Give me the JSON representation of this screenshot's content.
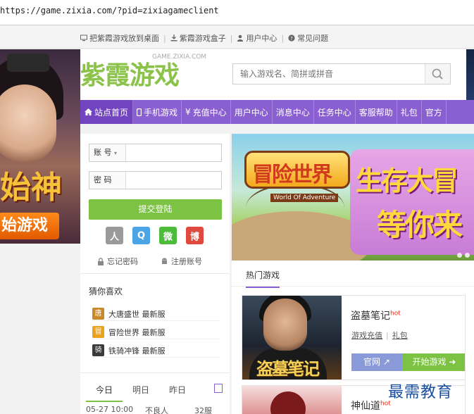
{
  "browser": {
    "url": "https://game.zixia.com/?pid=zixiagameclient"
  },
  "toplinks": [
    {
      "label": "把紫霞游戏放到桌面",
      "icon": "monitor-icon"
    },
    {
      "label": "紫霞游戏盒子",
      "icon": "download-icon"
    },
    {
      "label": "用户中心",
      "icon": "user-icon"
    },
    {
      "label": "常见问题",
      "icon": "question-icon"
    }
  ],
  "left_banner": {
    "title": "始神",
    "button": "始游戏"
  },
  "logo": {
    "cn": "紫霞游戏",
    "en": "GAME.ZIXIA.COM"
  },
  "search": {
    "placeholder": "输入游戏名、简拼或拼音",
    "icon": "search-icon"
  },
  "nav": [
    {
      "label": "站点首页",
      "icon": "home-icon",
      "active": true
    },
    {
      "label": "手机游戏",
      "icon": "mobile-icon"
    },
    {
      "label": "充值中心",
      "icon": "yen-icon"
    },
    {
      "label": "用户中心"
    },
    {
      "label": "消息中心"
    },
    {
      "label": "任务中心"
    },
    {
      "label": "客服帮助"
    },
    {
      "label": "礼包"
    },
    {
      "label": "官方"
    }
  ],
  "login": {
    "account_label": "账 号",
    "account_value": "",
    "password_label": "密 码",
    "password_value": "",
    "submit": "提交登陆",
    "social": [
      {
        "name": "user-icon",
        "glyph": "人"
      },
      {
        "name": "qq-icon",
        "glyph": "Q"
      },
      {
        "name": "wechat-icon",
        "glyph": "微"
      },
      {
        "name": "weibo-icon",
        "glyph": "博"
      }
    ],
    "forgot": "忘记密码",
    "register": "注册账号"
  },
  "guess": {
    "title": "猜你喜欢",
    "items": [
      {
        "label": "大唐盛世 最新服",
        "color": "#c9882a",
        "glyph": "唐"
      },
      {
        "label": "冒险世界 最新服",
        "color": "#e9a21a",
        "glyph": "冒"
      },
      {
        "label": "铁骑冲锋 最新服",
        "color": "#3a3a3a",
        "glyph": "骑"
      }
    ]
  },
  "days": {
    "tabs": [
      "今日",
      "明日",
      "昨日"
    ],
    "active": 0
  },
  "schedule": {
    "time": "05-27 10:00",
    "game": "不良人",
    "server": "32服"
  },
  "banner": {
    "logo": "冒险世界",
    "logo_en": "World Of Adventure",
    "line1": "生存大冒",
    "line2": "等你来"
  },
  "hot": {
    "title": "热门游戏",
    "games": [
      {
        "name": "盗墓笔记",
        "badge": "hot",
        "recharge": "游戏充值",
        "gift": "礼包",
        "official": "官网",
        "play": "开始游戏",
        "poster_title": "盗墓笔记"
      },
      {
        "name": "神仙道",
        "badge": "hot"
      }
    ]
  },
  "watermark": "最需教育"
}
